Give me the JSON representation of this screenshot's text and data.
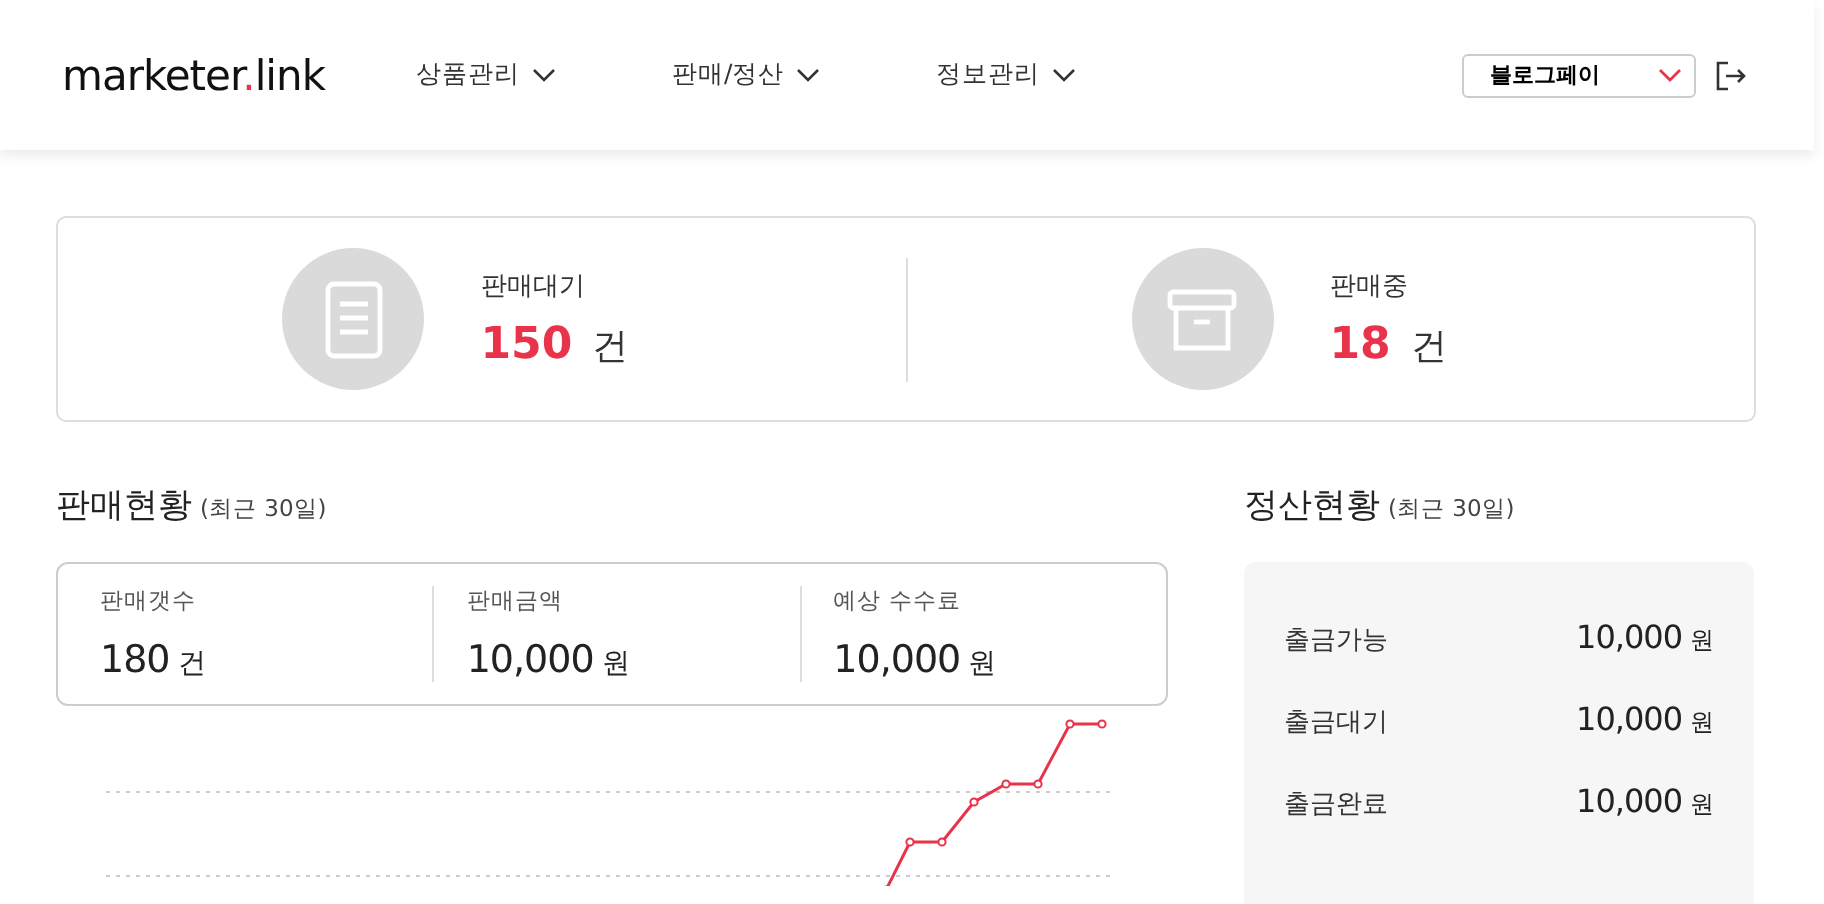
{
  "header": {
    "logo": {
      "before": "marketer",
      "dot": ".",
      "after": "link"
    },
    "menu": [
      {
        "label": "상품관리"
      },
      {
        "label": "판매/정산"
      },
      {
        "label": "정보관리"
      }
    ],
    "account_select": {
      "value": "블로그페이"
    }
  },
  "summary": [
    {
      "kind": "document",
      "label": "판매대기",
      "count": "150",
      "unit": "건"
    },
    {
      "kind": "box",
      "label": "판매중",
      "count": "18",
      "unit": "건"
    }
  ],
  "sales": {
    "title": "판매현황",
    "period": "(최근 30일)",
    "stats": [
      {
        "label": "판매갯수",
        "value": "180",
        "unit": "건"
      },
      {
        "label": "판매금액",
        "value": "10,000",
        "unit": "원"
      },
      {
        "label": "예상 수수료",
        "value": "10,000",
        "unit": "원"
      }
    ]
  },
  "settlement": {
    "title": "정산현황",
    "period": "(최근 30일)",
    "rows": [
      {
        "label": "출금가능",
        "value": "10,000",
        "unit": "원"
      },
      {
        "label": "출금대기",
        "value": "10,000",
        "unit": "원"
      },
      {
        "label": "출금완료",
        "value": "10,000",
        "unit": "원"
      }
    ]
  }
}
